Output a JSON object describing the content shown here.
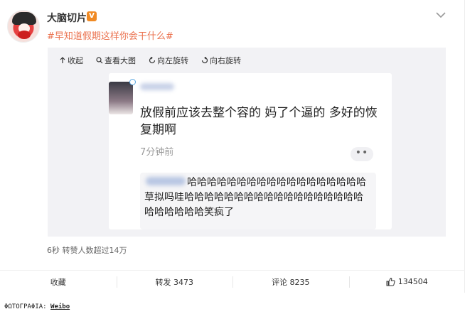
{
  "post": {
    "user_name": "大脑切片",
    "verified_badge": "V",
    "text": "#早知道假期这样你会干什么#"
  },
  "media_toolbar": {
    "collapse_label": "收起",
    "view_large_label": "查看大图",
    "rotate_left_label": "向左旋转",
    "rotate_right_label": "向右旋转"
  },
  "screenshot": {
    "content": "放假前应该去整个容的 妈了个逼的 多好的恢复期啊",
    "time": "7分钟前",
    "dots": "••",
    "comment": "哈哈哈哈哈哈哈哈哈哈哈哈哈哈哈哈哈哈草拟吗哇哈哈哈哈哈哈哈哈哈哈哈哈哈哈哈哈哈哈哈哈哈哈哈哈笑疯了"
  },
  "repost_stat": "6秒 转赞人数超过14万",
  "actions": {
    "favorite_label": "收藏",
    "repost_label": "转发 3473",
    "comment_label": "评论 8235",
    "like_count": "134504"
  },
  "credit": {
    "prefix": "ΦΩΤΟΓΡΑΦΙΑ:",
    "source": "Weibo"
  },
  "colors": {
    "topic": "#eb7350",
    "verified": "#f08a24"
  }
}
